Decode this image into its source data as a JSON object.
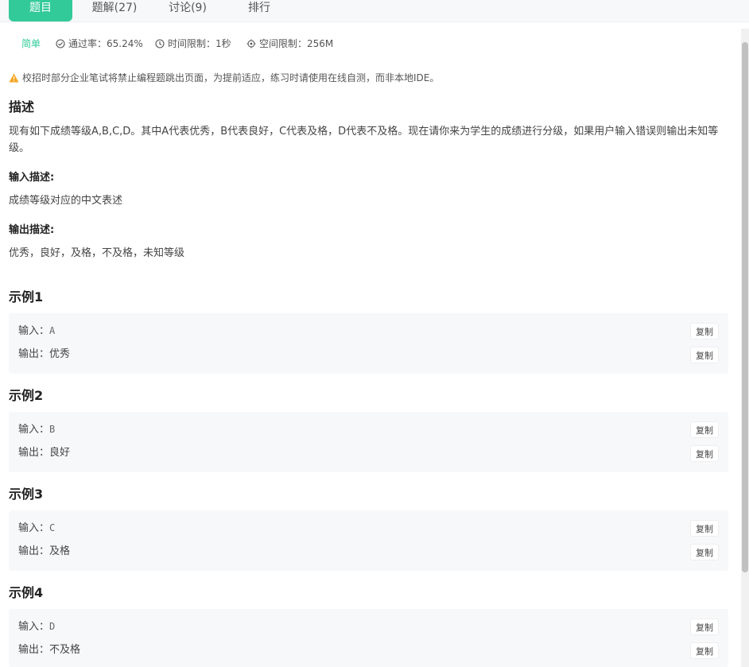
{
  "tabs": [
    {
      "label": "题目",
      "active": true
    },
    {
      "label": "题解(27)"
    },
    {
      "label": "讨论(9)"
    },
    {
      "label": "排行"
    }
  ],
  "meta": {
    "difficulty": "简单",
    "pass_rate": "通过率：65.24%",
    "time_limit": "时间限制：1秒",
    "space_limit": "空间限制：256M"
  },
  "notice": "校招时部分企业笔试将禁止编程题跳出页面，为提前适应，练习时请使用在线自测，而非本地IDE。",
  "description": {
    "title": "描述",
    "text": "现有如下成绩等级A,B,C,D。其中A代表优秀，B代表良好，C代表及格，D代表不及格。现在请你来为学生的成绩进行分级，如果用户输入错误则输出未知等级。",
    "input_title": "输入描述:",
    "input_text": "成绩等级对应的中文表述",
    "output_title": "输出描述:",
    "output_text": "优秀，良好，及格，不及格，未知等级"
  },
  "examples": [
    {
      "title": "示例1",
      "input_label": "输入：",
      "input": "A",
      "output_label": "输出：",
      "output": "优秀",
      "copy": "复制"
    },
    {
      "title": "示例2",
      "input_label": "输入：",
      "input": "B",
      "output_label": "输出：",
      "output": "良好",
      "copy": "复制"
    },
    {
      "title": "示例3",
      "input_label": "输入：",
      "input": "C",
      "output_label": "输出：",
      "output": "及格",
      "copy": "复制"
    },
    {
      "title": "示例4",
      "input_label": "输入：",
      "input": "D",
      "output_label": "输出：",
      "output": "不及格",
      "copy": "复制"
    }
  ],
  "icons": {
    "pass_rate": "check-circle-icon",
    "time_limit": "clock-icon",
    "space_limit": "target-icon",
    "notice": "warning-triangle-icon"
  },
  "colors": {
    "accent": "#32ca99",
    "warning": "#f5a623"
  }
}
